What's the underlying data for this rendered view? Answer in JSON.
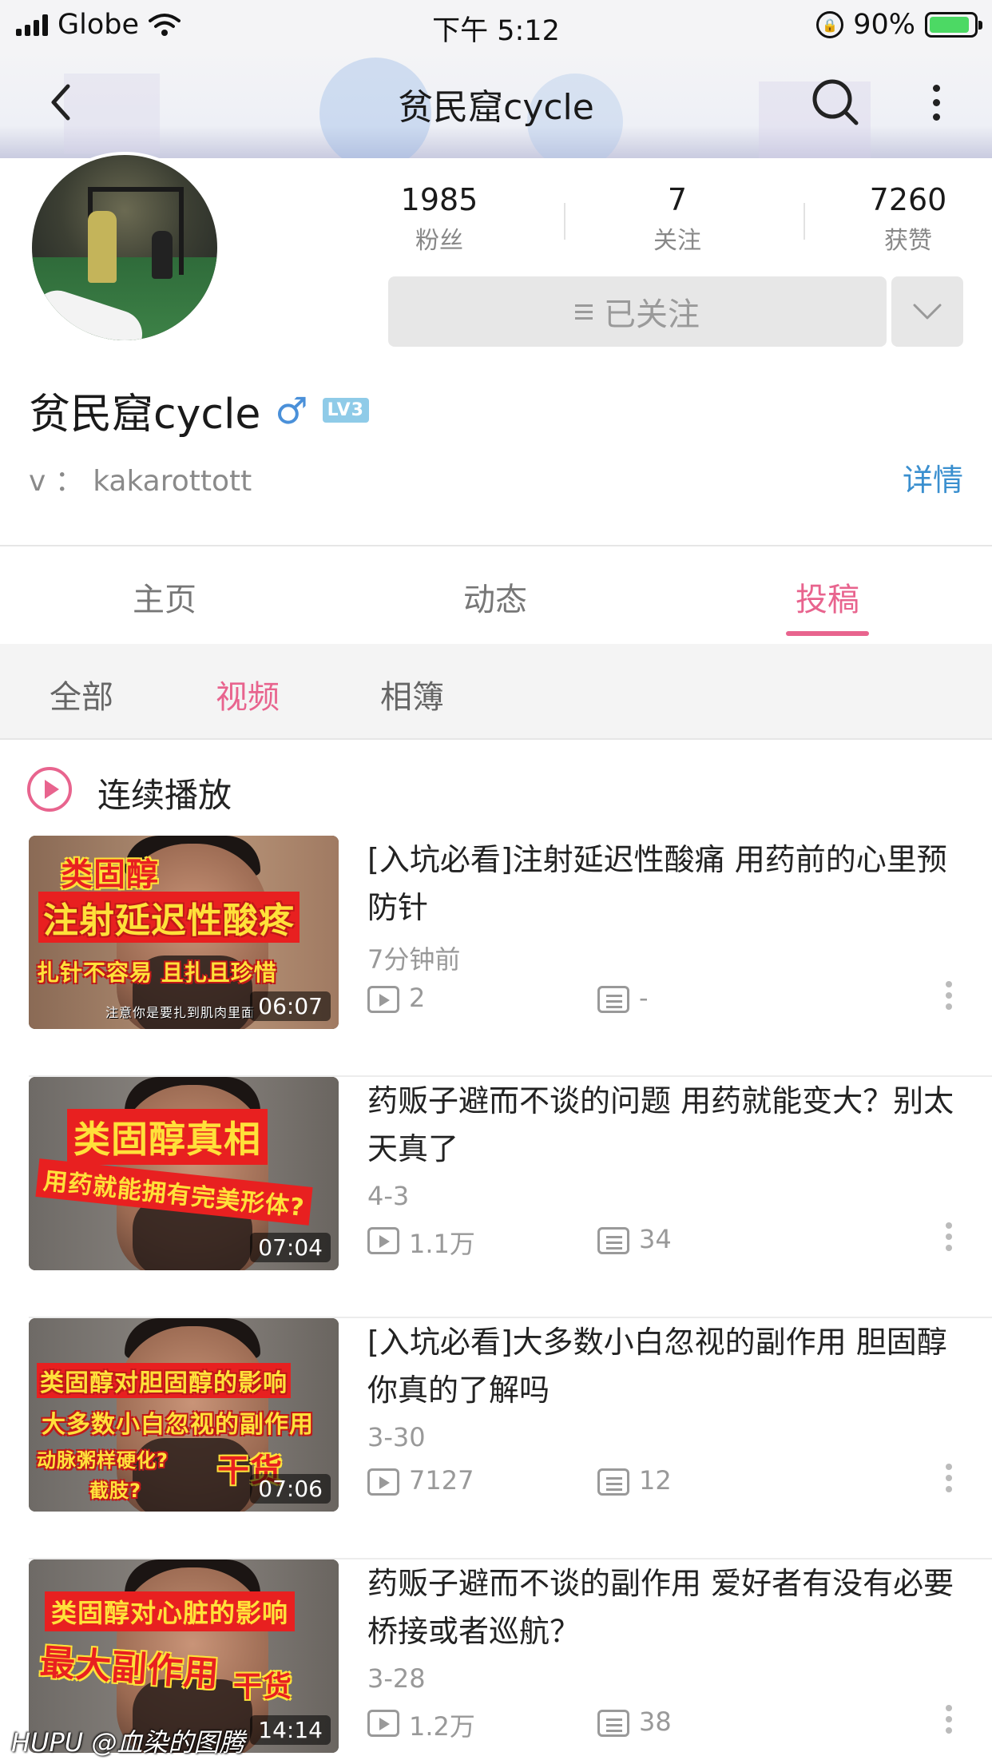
{
  "status_bar": {
    "carrier": "Globe",
    "time": "下午 5:12",
    "battery_percent": "90%",
    "battery_level": 0.9
  },
  "nav": {
    "title": "贫民窟cycle",
    "back_icon": "chevron-left-icon",
    "search_icon": "search-icon",
    "more_icon": "more-vertical-icon"
  },
  "profile": {
    "stats": [
      {
        "num": "1985",
        "label": "粉丝"
      },
      {
        "num": "7",
        "label": "关注"
      },
      {
        "num": "7260",
        "label": "获赞"
      }
    ],
    "follow_label": "已关注",
    "username": "贫民窟cycle",
    "gender_symbol": "♂",
    "level": "LV3",
    "signature": "v ： kakarottott",
    "detail_link": "详情"
  },
  "tabs": [
    {
      "label": "主页"
    },
    {
      "label": "动态"
    },
    {
      "label": "投稿"
    }
  ],
  "active_tab": "投稿",
  "subfilter": [
    {
      "label": "全部"
    },
    {
      "label": "视频"
    },
    {
      "label": "相簿"
    }
  ],
  "active_subfilter": "视频",
  "autoplay_label": "连续播放",
  "videos": [
    {
      "title": "[入坑必看]注射延迟性酸痛  用药前的心里预防针",
      "date": "7分钟前",
      "plays": "2",
      "comments": "-",
      "duration": "06:07",
      "captions": [
        "类固醇",
        "注射延迟性酸疼",
        "扎针不容易 且扎且珍惜",
        "注意你是要扎到肌肉里面"
      ]
    },
    {
      "title": "药贩子避而不谈的问题  用药就能变大？别太天真了",
      "date": "4-3",
      "plays": "1.1万",
      "comments": "34",
      "duration": "07:04",
      "captions": [
        "类固醇真相",
        "用药就能拥有完美形体?"
      ]
    },
    {
      "title": "[入坑必看]大多数小白忽视的副作用  胆固醇  你真的了解吗",
      "date": "3-30",
      "plays": "7127",
      "comments": "12",
      "duration": "07:06",
      "captions": [
        "类固醇对胆固醇的影响",
        "大多数小白忽视的副作用",
        "动脉粥样硬化?",
        "截肢?",
        "干货"
      ]
    },
    {
      "title": "药贩子避而不谈的副作用  爱好者有没有必要桥接或者巡航？",
      "date": "3-28",
      "plays": "1.2万",
      "comments": "38",
      "duration": "14:14",
      "captions": [
        "类固醇对心脏的影响",
        "最大副作用",
        "干货"
      ]
    }
  ],
  "watermark": "HUPU @血染的图腾",
  "colors": {
    "accent": "#e8648e",
    "link": "#3a8fcf",
    "muted": "#999999"
  }
}
